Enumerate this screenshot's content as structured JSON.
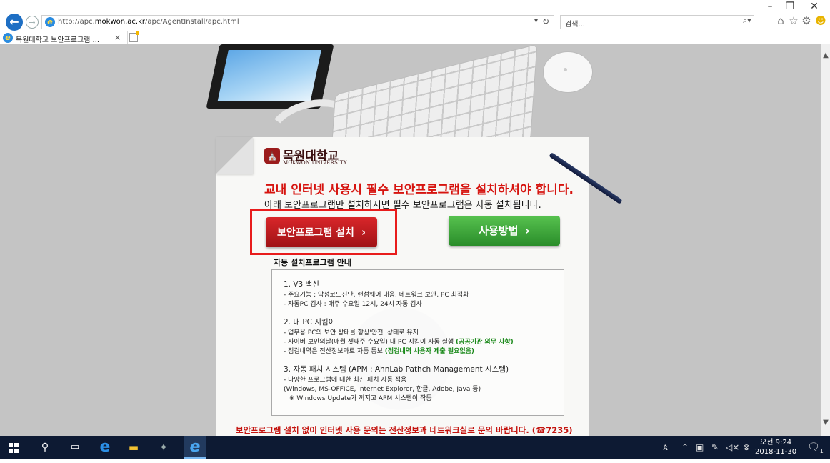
{
  "browser": {
    "url_prefix": "http://apc.",
    "url_domain": "mokwon.ac.kr",
    "url_path": "/apc/AgentInstall/apc.html",
    "search_placeholder": "검색...",
    "tab_title": "목원대학교 보안프로그램 ...",
    "tab_close": "×"
  },
  "page": {
    "logo_kr": "목원대학교",
    "logo_en": "MOKWON UNIVERSITY",
    "headline": "교내 인터넷 사용시 필수 보안프로그램을 설치하셔야 합니다.",
    "subline": "아래 보안프로그램만 설치하시면 필수 보안프로그램은 자동 설치됩니다.",
    "install_button": "보안프로그램 설치",
    "usage_button": "사용방법",
    "chevron": "›",
    "guide_title": "자동 설치프로그램 안내",
    "guide": {
      "s1_title": "1. V3 백신",
      "s1_l1": "- 주요기능 : 악성코드진단, 랜섬웨어 대응, 네트워크 보안, PC 최적화",
      "s1_l2": "- 자동PC 검사 : 매주 수요일 12시, 24시 자동 검사",
      "s2_title": "2. 내 PC 지킴이",
      "s2_l1": "- 업무용 PC의 보안 상태를 항상'안전' 상태로 유지",
      "s2_l2": "- 사이버 보안의날(매월 셋째주 수요일) 내 PC 지킴이 자동 실행",
      "s2_l2_green": "(공공기관 의무 사항)",
      "s2_l3": "- 점검내역은 전산정보과로 자동 통보",
      "s2_l3_green": "(점검내역 사용자 제출 필요없음)",
      "s3_title": "3. 자동 패치 시스템 (APM : AhnLab Pathch Management 시스템)",
      "s3_l1": "- 다양한 프로그램에 대한 최신 패치 자동 적용",
      "s3_l2": "(Windows, MS-OFFICE, Internet Explorer, 한글, Adobe, Java 등)",
      "s3_l3": "※ Windows Update가 꺼지고 APM 시스템이 작동"
    },
    "footer_note": "보안프로그램 설치 없이 인터넷 사용 문의는 전산정보과 네트워크실로 문의 바랍니다. (☎7235)"
  },
  "taskbar": {
    "time": "오전 9:24",
    "date": "2018-11-30",
    "notification_count": "1"
  },
  "colors": {
    "headline_red": "#d6140f",
    "install_red": "#c0191d",
    "usage_green": "#3aa838",
    "highlight_red": "#e81c1c"
  }
}
